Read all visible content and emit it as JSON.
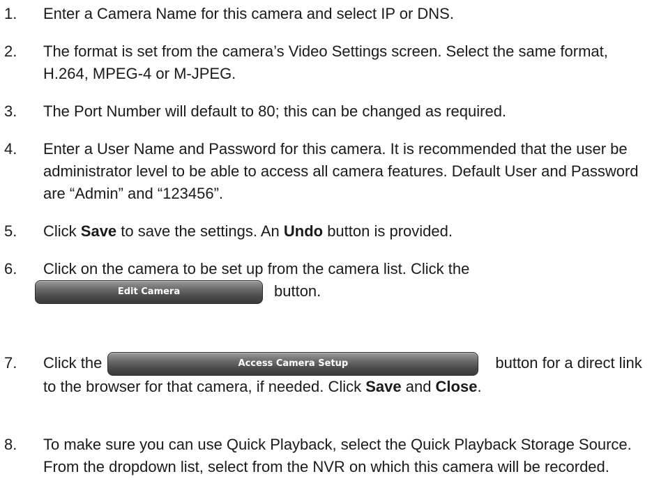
{
  "steps": [
    {
      "num": "1.",
      "text": "Enter a Camera Name for this camera and select IP or DNS."
    },
    {
      "num": "2.",
      "text": "The format is set from the camera’s Video Settings screen. Select the same format, H.264, MPEG-4 or M-JPEG."
    },
    {
      "num": "3.",
      "text": "The Port Number will default to 80; this can be changed as required."
    },
    {
      "num": "4.",
      "text": "Enter a User Name and Password for this camera. It is recommended that the user be administrator level to be able to access all camera features. Default User and Password are “Admin” and “123456”."
    },
    {
      "num": "5.",
      "part1": "Click ",
      "bold1": "Save",
      "part2": " to save the settings. An ",
      "bold2": "Undo",
      "part3": " button is provided."
    },
    {
      "num": "6.",
      "part1": "Click on the camera to be set up from the camera list. Click the",
      "button_label": "Edit Camera",
      "part2": "button."
    },
    {
      "num": "7.",
      "part1": "Click the",
      "button_label": "Access Camera Setup",
      "part2": "button for a direct link to the browser for that camera, if needed. Click ",
      "bold1": "Save",
      "part3": " and ",
      "bold2": "Close",
      "part4": "."
    },
    {
      "num": "8.",
      "text": "To make sure you can use Quick Playback, select the Quick Playback Storage Source. From the dropdown list, select from the NVR on which this camera will be recorded."
    }
  ]
}
